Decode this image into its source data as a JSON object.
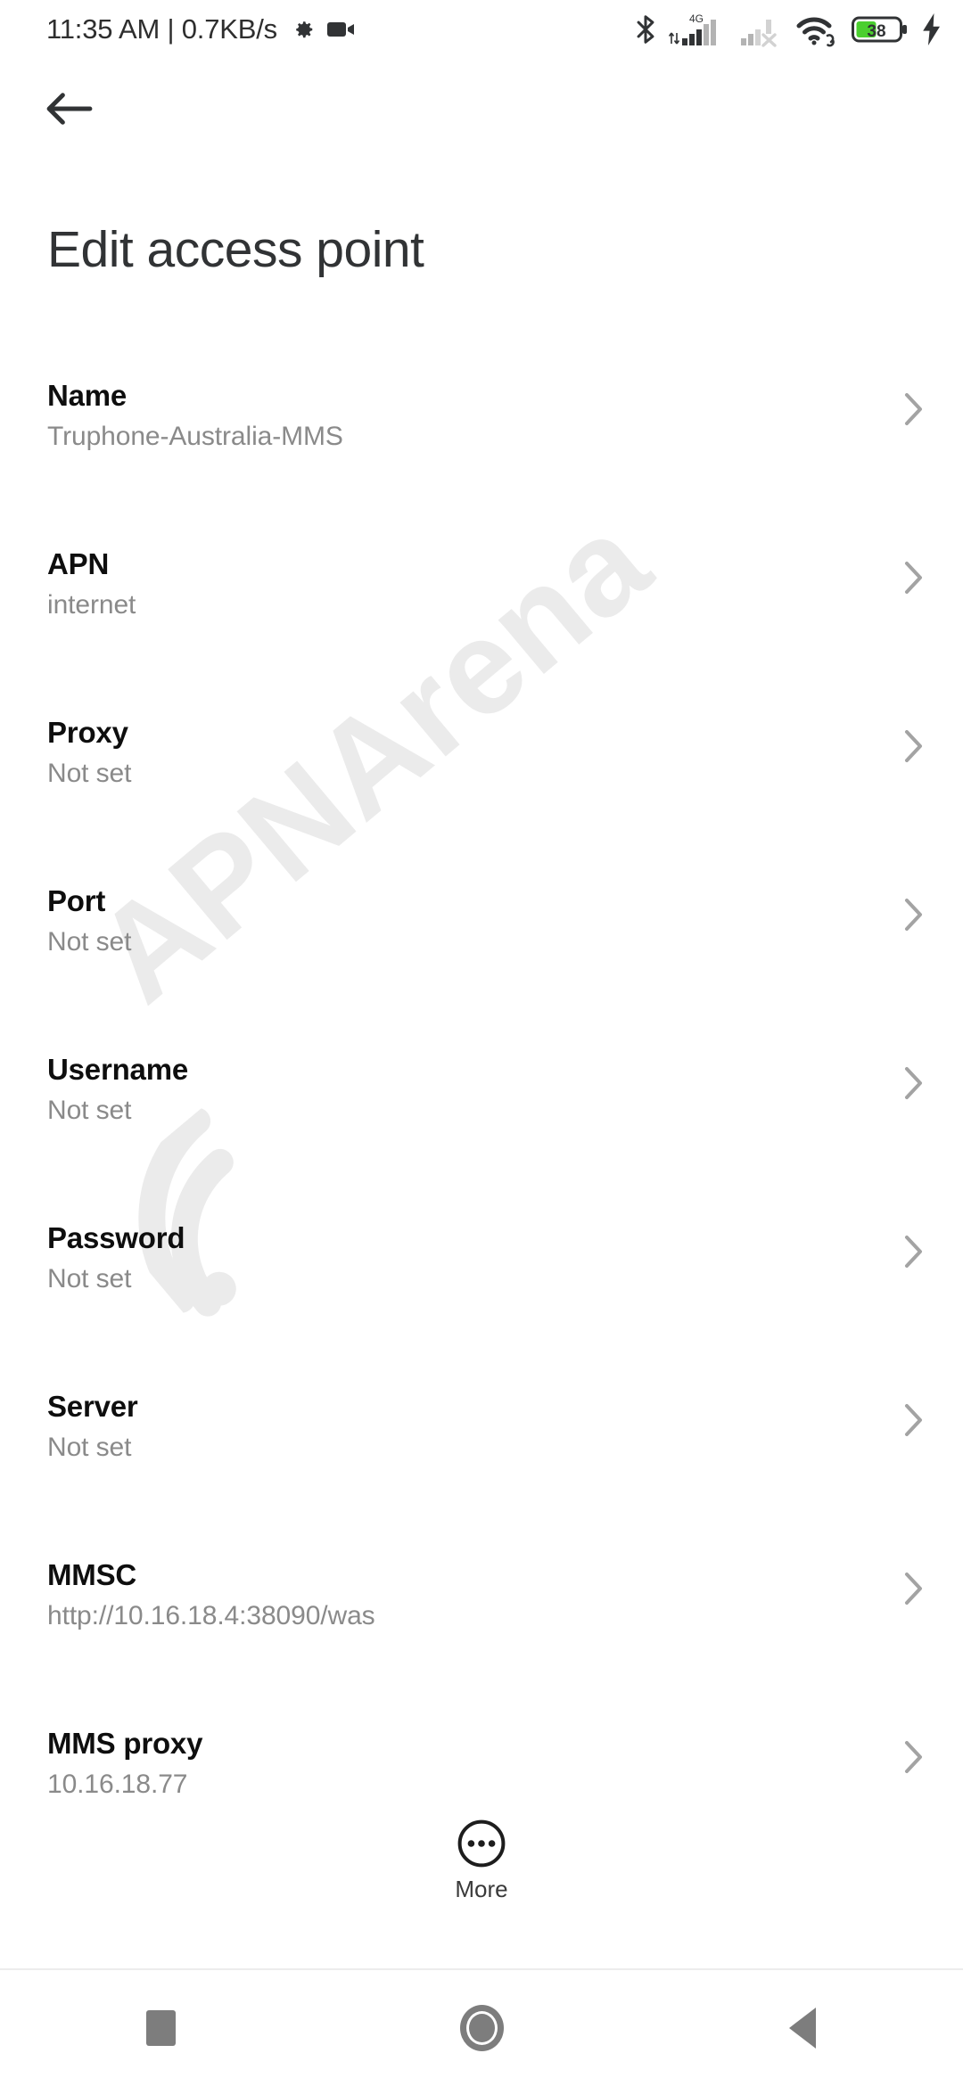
{
  "status_bar": {
    "clock_and_speed": "11:35 AM | 0.7KB/s",
    "icons": [
      "gear-icon",
      "video-camera-icon",
      "bluetooth-icon",
      "signal-4g-icon",
      "signal-no-service-icon",
      "wifi-icon",
      "battery-icon",
      "charging-bolt-icon"
    ],
    "network_type": "4G",
    "battery_percent": "38",
    "battery_color": "#4ACF2E"
  },
  "app_bar": {
    "back_label": "Back"
  },
  "header": {
    "title": "Edit access point"
  },
  "watermark": {
    "text": "APNArena",
    "color": "#ebebeb"
  },
  "list": {
    "rows": [
      {
        "label": "Name",
        "value": "Truphone-Australia-MMS"
      },
      {
        "label": "APN",
        "value": "internet"
      },
      {
        "label": "Proxy",
        "value": "Not set"
      },
      {
        "label": "Port",
        "value": "Not set"
      },
      {
        "label": "Username",
        "value": "Not set"
      },
      {
        "label": "Password",
        "value": "Not set"
      },
      {
        "label": "Server",
        "value": "Not set"
      },
      {
        "label": "MMSC",
        "value": "http://10.16.18.4:38090/was"
      },
      {
        "label": "MMS proxy",
        "value": "10.16.18.77"
      }
    ]
  },
  "more_button": {
    "label": "More"
  },
  "nav_bar": {
    "recents_label": "Recents",
    "home_label": "Home",
    "back_label": "Back"
  }
}
